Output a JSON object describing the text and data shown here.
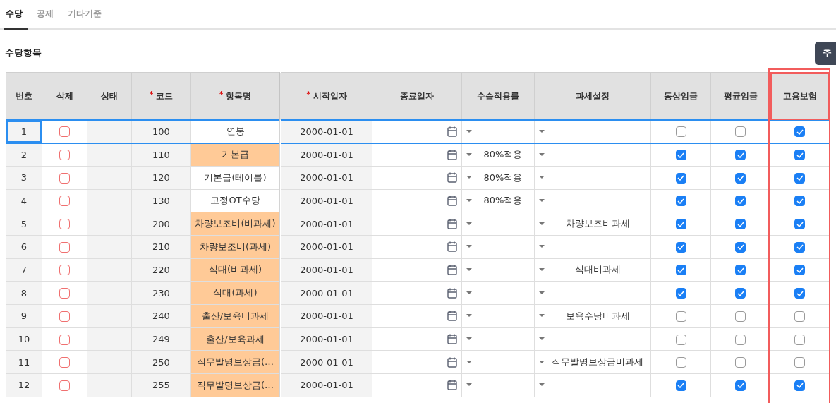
{
  "tabs": [
    {
      "label": "수당",
      "selected": true
    },
    {
      "label": "공제",
      "selected": false
    },
    {
      "label": "기타기준",
      "selected": false
    }
  ],
  "section": {
    "title": "수당항목",
    "button": "추"
  },
  "table": {
    "columns": [
      {
        "label": "번호",
        "highlighted": false
      },
      {
        "label": "삭제",
        "highlighted": false
      },
      {
        "label": "상태",
        "highlighted": false
      },
      {
        "label": "코드",
        "required_mark": "*",
        "highlighted": false
      },
      {
        "label": "항목명",
        "required_mark": "*",
        "highlighted": false
      },
      {
        "label": "시작일자",
        "required_mark": "*",
        "highlighted": false
      },
      {
        "label": "종료일자",
        "highlighted": false
      },
      {
        "label": "수습적용률",
        "highlighted": false
      },
      {
        "label": "과세설정",
        "highlighted": false
      },
      {
        "label": "동상임금",
        "highlighted": false
      },
      {
        "label": "평균임금",
        "highlighted": false
      },
      {
        "label": "고용보험",
        "highlighted": true
      }
    ],
    "rows": [
      {
        "no": "1",
        "selected": true,
        "delete": false,
        "code": "100",
        "name": "연봉",
        "name_highlighted": false,
        "start": "2000-01-01",
        "probation": "",
        "tax": "",
        "ordinary": false,
        "average": false,
        "insurance": true
      },
      {
        "no": "2",
        "selected": false,
        "delete": false,
        "code": "110",
        "name": "기본급",
        "name_highlighted": true,
        "start": "2000-01-01",
        "probation": "80%적용",
        "tax": "",
        "ordinary": true,
        "average": true,
        "insurance": true
      },
      {
        "no": "3",
        "selected": false,
        "delete": false,
        "code": "120",
        "name": "기본급(테이블)",
        "name_highlighted": false,
        "start": "2000-01-01",
        "probation": "80%적용",
        "tax": "",
        "ordinary": true,
        "average": true,
        "insurance": true
      },
      {
        "no": "4",
        "selected": false,
        "delete": false,
        "code": "130",
        "name": "고정OT수당",
        "name_highlighted": false,
        "start": "2000-01-01",
        "probation": "80%적용",
        "tax": "",
        "ordinary": true,
        "average": true,
        "insurance": true
      },
      {
        "no": "5",
        "selected": false,
        "delete": false,
        "code": "200",
        "name": "차량보조비(비과세)",
        "name_highlighted": true,
        "start": "2000-01-01",
        "probation": "",
        "tax": "차량보조비과세",
        "ordinary": true,
        "average": true,
        "insurance": true
      },
      {
        "no": "6",
        "selected": false,
        "delete": false,
        "code": "210",
        "name": "차량보조비(과세)",
        "name_highlighted": true,
        "start": "2000-01-01",
        "probation": "",
        "tax": "",
        "ordinary": true,
        "average": true,
        "insurance": true
      },
      {
        "no": "7",
        "selected": false,
        "delete": false,
        "code": "220",
        "name": "식대(비과세)",
        "name_highlighted": true,
        "start": "2000-01-01",
        "probation": "",
        "tax": "식대비과세",
        "ordinary": true,
        "average": true,
        "insurance": true
      },
      {
        "no": "8",
        "selected": false,
        "delete": false,
        "code": "230",
        "name": "식대(과세)",
        "name_highlighted": true,
        "start": "2000-01-01",
        "probation": "",
        "tax": "",
        "ordinary": true,
        "average": true,
        "insurance": true
      },
      {
        "no": "9",
        "selected": false,
        "delete": false,
        "code": "240",
        "name": "출산/보육비과세",
        "name_highlighted": true,
        "start": "2000-01-01",
        "probation": "",
        "tax": "보육수당비과세",
        "ordinary": false,
        "average": false,
        "insurance": false
      },
      {
        "no": "10",
        "selected": false,
        "delete": false,
        "code": "249",
        "name": "출산/보육과세",
        "name_highlighted": true,
        "start": "2000-01-01",
        "probation": "",
        "tax": "",
        "ordinary": false,
        "average": false,
        "insurance": false
      },
      {
        "no": "11",
        "selected": false,
        "delete": false,
        "code": "250",
        "name": "직무발명보상금(…",
        "name_highlighted": true,
        "start": "2000-01-01",
        "probation": "",
        "tax": "직무발명보상금비과세",
        "ordinary": false,
        "average": false,
        "insurance": false
      },
      {
        "no": "12",
        "selected": false,
        "delete": false,
        "code": "255",
        "name": "직무발명보상금(…",
        "name_highlighted": true,
        "start": "2000-01-01",
        "probation": "",
        "tax": "",
        "ordinary": true,
        "average": true,
        "insurance": true
      }
    ]
  }
}
